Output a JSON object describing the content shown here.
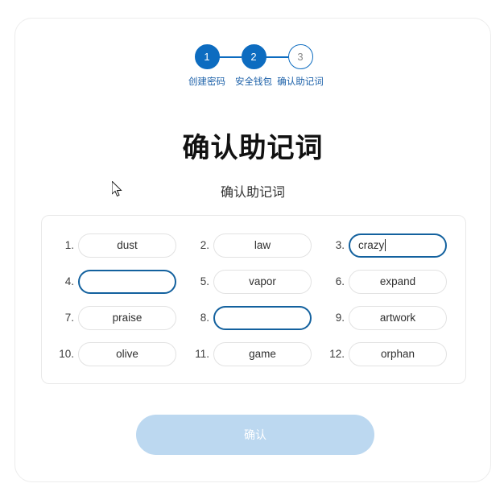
{
  "stepper": {
    "steps": [
      {
        "number": "1",
        "label": "创建密码",
        "state": "done"
      },
      {
        "number": "2",
        "label": "安全钱包",
        "state": "done"
      },
      {
        "number": "3",
        "label": "确认助记词",
        "state": "todo"
      }
    ]
  },
  "page": {
    "title": "确认助记词",
    "subtitle": "确认助记词"
  },
  "mnemonic": {
    "cells": [
      {
        "index": "1.",
        "value": "dust",
        "state": "filled"
      },
      {
        "index": "2.",
        "value": "law",
        "state": "filled"
      },
      {
        "index": "3.",
        "value": "crazy",
        "state": "focused"
      },
      {
        "index": "4.",
        "value": "",
        "state": "blank"
      },
      {
        "index": "5.",
        "value": "vapor",
        "state": "filled"
      },
      {
        "index": "6.",
        "value": "expand",
        "state": "filled"
      },
      {
        "index": "7.",
        "value": "praise",
        "state": "filled"
      },
      {
        "index": "8.",
        "value": "",
        "state": "blank"
      },
      {
        "index": "9.",
        "value": "artwork",
        "state": "filled"
      },
      {
        "index": "10.",
        "value": "olive",
        "state": "filled"
      },
      {
        "index": "11.",
        "value": "game",
        "state": "filled"
      },
      {
        "index": "12.",
        "value": "orphan",
        "state": "filled"
      }
    ]
  },
  "actions": {
    "submit_label": "确认"
  },
  "colors": {
    "accent": "#0d6cc0",
    "focus_border": "#13619e",
    "button_disabled": "#bcd8f0",
    "step_label": "#1a5fa8"
  }
}
